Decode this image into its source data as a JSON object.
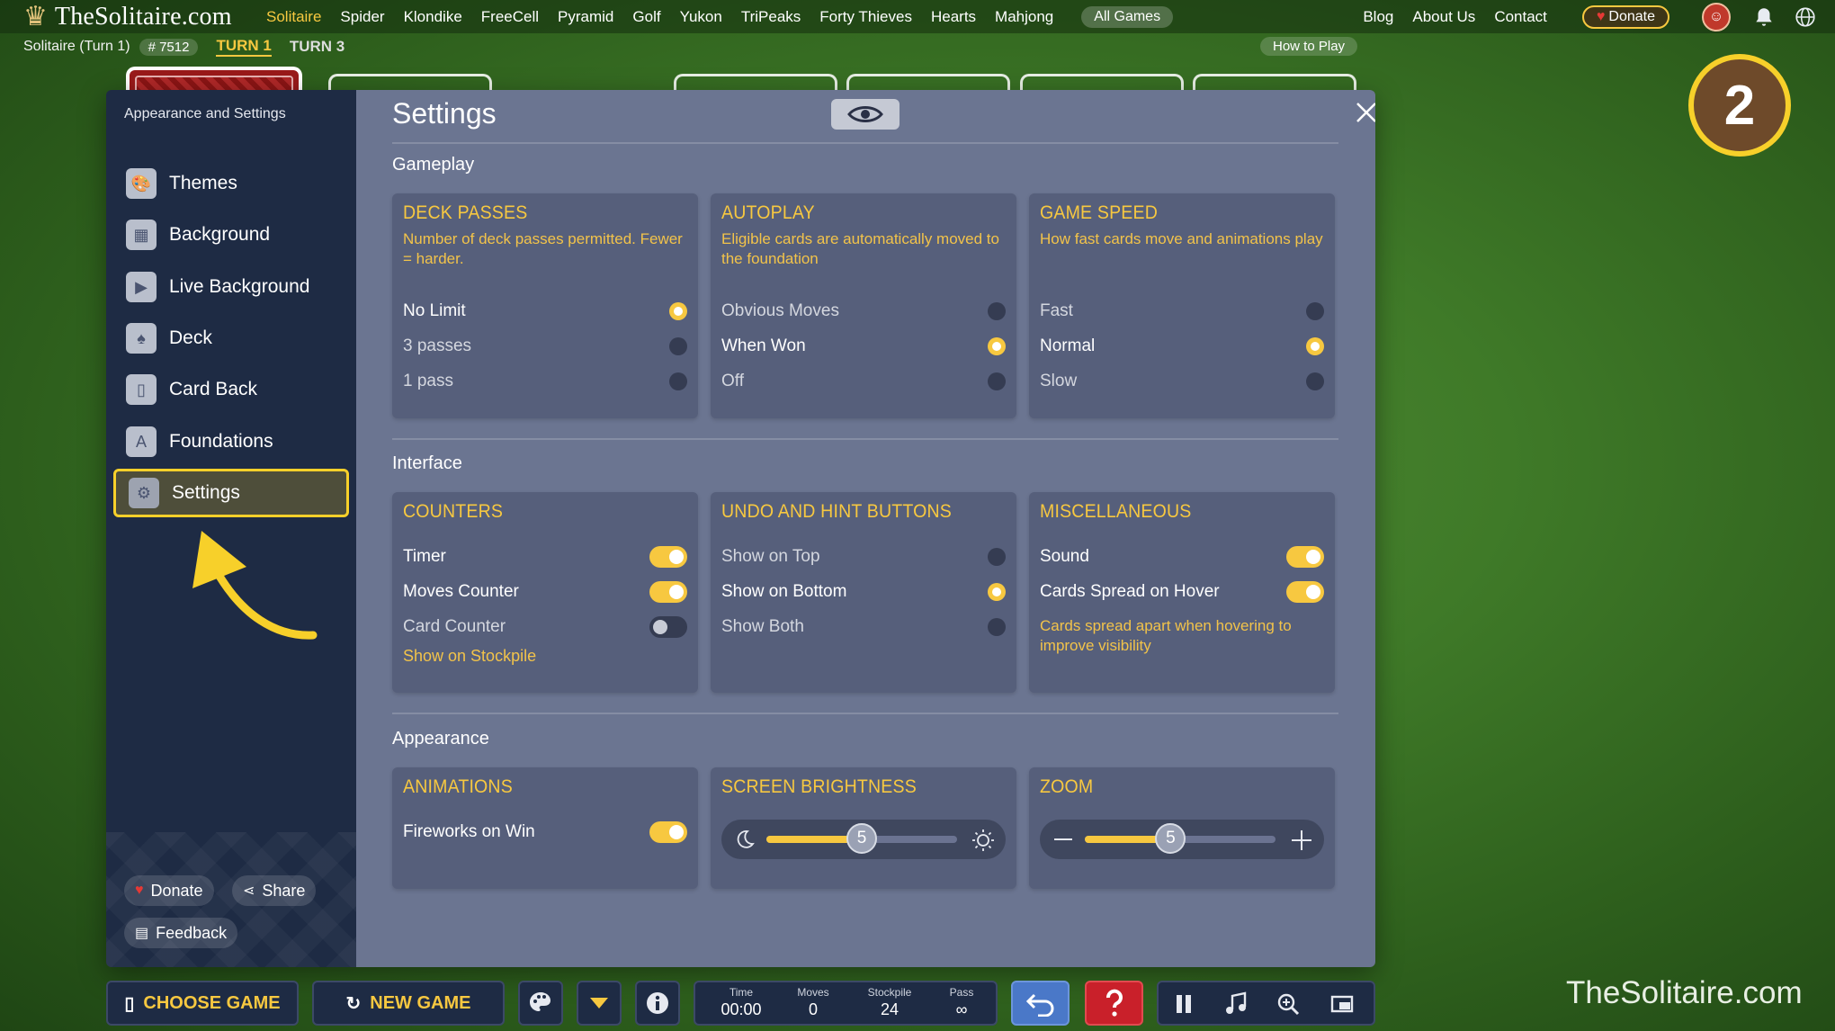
{
  "site": {
    "logo_text": "TheSolitaire.com",
    "nav": [
      "Solitaire",
      "Spider",
      "Klondike",
      "FreeCell",
      "Pyramid",
      "Golf",
      "Yukon",
      "TriPeaks",
      "Forty Thieves",
      "Hearts",
      "Mahjong"
    ],
    "nav_active": "Solitaire",
    "all_games": "All Games",
    "right_links": [
      "Blog",
      "About Us",
      "Contact"
    ],
    "donate": "Donate",
    "accent": "#f7c840"
  },
  "subbar": {
    "title": "Solitaire (Turn 1)",
    "game_number": "# 7512",
    "turn1": "TURN 1",
    "turn3": "TURN 3",
    "how_to_play": "How to Play"
  },
  "modal": {
    "sidebar_heading": "Appearance and Settings",
    "sidebar_items": [
      {
        "label": "Themes",
        "icon": "palette-icon"
      },
      {
        "label": "Background",
        "icon": "image-icon"
      },
      {
        "label": "Live Background",
        "icon": "film-icon"
      },
      {
        "label": "Deck",
        "icon": "spade-icon"
      },
      {
        "label": "Card Back",
        "icon": "card-back-icon"
      },
      {
        "label": "Foundations",
        "icon": "foundation-icon"
      },
      {
        "label": "Settings",
        "icon": "gear-icon"
      }
    ],
    "selected_item": "Settings",
    "footer": {
      "donate": "Donate",
      "share": "Share",
      "feedback": "Feedback"
    },
    "title": "Settings",
    "sections": {
      "gameplay": "Gameplay",
      "interface": "Interface",
      "appearance": "Appearance"
    },
    "deck_passes": {
      "title": "DECK PASSES",
      "desc": "Number of deck passes permitted. Fewer = harder.",
      "options": [
        "No Limit",
        "3 passes",
        "1 pass"
      ],
      "selected": "No Limit"
    },
    "autoplay": {
      "title": "AUTOPLAY",
      "desc": "Eligible cards are automatically moved to the foundation",
      "options": [
        "Obvious Moves",
        "When Won",
        "Off"
      ],
      "selected": "When Won"
    },
    "game_speed": {
      "title": "GAME SPEED",
      "desc": "How fast cards move and animations play",
      "options": [
        "Fast",
        "Normal",
        "Slow"
      ],
      "selected": "Normal"
    },
    "counters": {
      "title": "COUNTERS",
      "toggles": [
        {
          "label": "Timer",
          "on": true
        },
        {
          "label": "Moves Counter",
          "on": true
        },
        {
          "label": "Card Counter",
          "on": false
        }
      ],
      "subtext": "Show on Stockpile"
    },
    "undo_hint": {
      "title": "UNDO AND HINT BUTTONS",
      "options": [
        "Show on Top",
        "Show on Bottom",
        "Show Both"
      ],
      "selected": "Show on Bottom"
    },
    "misc": {
      "title": "MISCELLANEOUS",
      "toggles": [
        {
          "label": "Sound",
          "on": true
        },
        {
          "label": "Cards Spread on Hover",
          "on": true
        }
      ],
      "desc": "Cards spread apart when hovering to improve visibility"
    },
    "animations": {
      "title": "ANIMATIONS",
      "toggles": [
        {
          "label": "Fireworks on Win",
          "on": true
        }
      ]
    },
    "brightness": {
      "title": "SCREEN BRIGHTNESS",
      "value": "5",
      "fill_fraction": 0.5
    },
    "zoom": {
      "title": "ZOOM",
      "value": "5",
      "fill_fraction": 0.45
    }
  },
  "step_badge": "2",
  "bottom": {
    "choose_game": "CHOOSE GAME",
    "new_game": "NEW GAME",
    "stats": [
      {
        "label": "Time",
        "value": "00:00"
      },
      {
        "label": "Moves",
        "value": "0"
      },
      {
        "label": "Stockpile",
        "value": "24"
      },
      {
        "label": "Pass",
        "value": "∞"
      }
    ]
  },
  "watermark": "TheSolitaire.com"
}
